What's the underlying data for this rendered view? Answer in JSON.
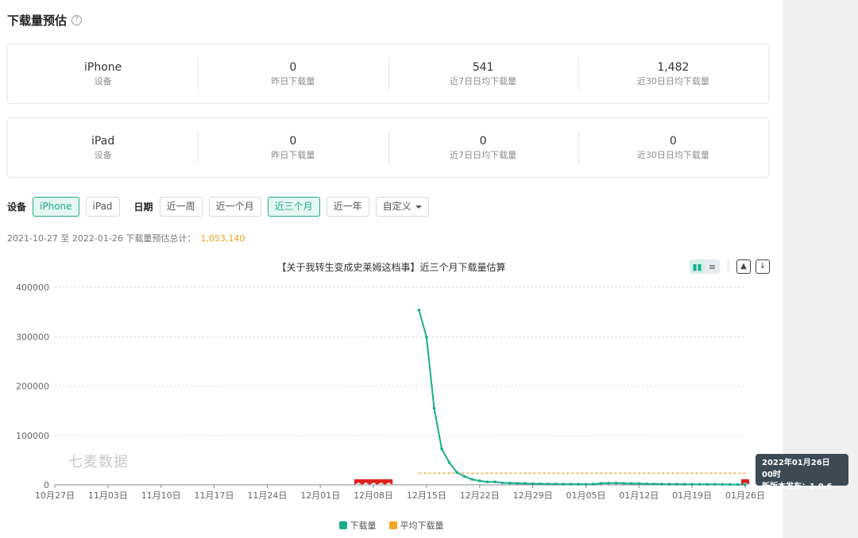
{
  "header": {
    "title": "下载量预估",
    "help_icon": "question-circle-icon"
  },
  "devices_stats": [
    {
      "device": "iPhone",
      "device_label": "设备",
      "yesterday": "0",
      "yesterday_label": "昨日下载量",
      "avg7": "541",
      "avg7_label": "近7日日均下载量",
      "avg30": "1,482",
      "avg30_label": "近30日日均下载量"
    },
    {
      "device": "iPad",
      "device_label": "设备",
      "yesterday": "0",
      "yesterday_label": "昨日下载量",
      "avg7": "0",
      "avg7_label": "近7日日均下载量",
      "avg30": "0",
      "avg30_label": "近30日日均下载量"
    }
  ],
  "filters": {
    "device_label": "设备",
    "device_options": [
      "iPhone",
      "iPad"
    ],
    "device_selected": "iPhone",
    "date_label": "日期",
    "date_options": [
      "近一周",
      "近一个月",
      "近三个月",
      "近一年",
      "自定义"
    ],
    "date_selected": "近三个月"
  },
  "summary": {
    "text": "2021-10-27 至 2022-01-26 下载量预估总计：",
    "total": "1,053,140"
  },
  "watermark": "七麦数据",
  "tooltip": {
    "line1": "2022年01月26日 00时",
    "line2": "新版本发布：1.0.6"
  },
  "colors": {
    "accent": "#1aad8c",
    "average": "#f5a623",
    "release_flag": "#e02020"
  },
  "chart_data": {
    "type": "line",
    "title": "【关于我转生变成史莱姆这档事】近三个月下载量估算",
    "start_date": "2021-10-27",
    "x_tick_labels": [
      "10月27日",
      "11月03日",
      "11月10日",
      "11月17日",
      "11月24日",
      "12月01日",
      "12月08日",
      "12月15日",
      "12月22日",
      "12月29日",
      "01月05日",
      "01月12日",
      "01月19日",
      "01月26日"
    ],
    "ylim": [
      0,
      400000
    ],
    "y_ticks": [
      0,
      100000,
      200000,
      300000,
      400000
    ],
    "grid": true,
    "legend": "bottom-center",
    "series": [
      {
        "name": "下载量",
        "color": "#1aad8c",
        "x": [
          "2021-12-14",
          "2021-12-15",
          "2021-12-16",
          "2021-12-17",
          "2021-12-18",
          "2021-12-19",
          "2021-12-20",
          "2021-12-21",
          "2021-12-22",
          "2021-12-23",
          "2021-12-24",
          "2021-12-25",
          "2021-12-26",
          "2021-12-27",
          "2021-12-28",
          "2021-12-29",
          "2021-12-30",
          "2021-12-31",
          "2022-01-01",
          "2022-01-02",
          "2022-01-03",
          "2022-01-04",
          "2022-01-05",
          "2022-01-06",
          "2022-01-07",
          "2022-01-08",
          "2022-01-09",
          "2022-01-10",
          "2022-01-11",
          "2022-01-12",
          "2022-01-13",
          "2022-01-14",
          "2022-01-15",
          "2022-01-16",
          "2022-01-17",
          "2022-01-18",
          "2022-01-19",
          "2022-01-20",
          "2022-01-21",
          "2022-01-22",
          "2022-01-23",
          "2022-01-24",
          "2022-01-25",
          "2022-01-26"
        ],
        "values": [
          354000,
          299000,
          155000,
          73000,
          45000,
          25000,
          17000,
          11000,
          8000,
          6000,
          6000,
          4000,
          3500,
          3000,
          2800,
          2200,
          2000,
          1800,
          1600,
          1500,
          1400,
          1300,
          1200,
          1500,
          3000,
          3500,
          3500,
          3000,
          2500,
          2500,
          2000,
          1800,
          1500,
          1300,
          1200,
          1100,
          1000,
          1000,
          900,
          900,
          800,
          700,
          600,
          500
        ]
      },
      {
        "name": "平均下载量",
        "color": "#f5a623",
        "dashed": true,
        "x": [
          "2021-12-14",
          "2022-01-26"
        ],
        "values": [
          23400,
          23400
        ]
      }
    ],
    "release_markers": [
      "2021-12-06",
      "2021-12-07",
      "2021-12-08",
      "2021-12-09",
      "2021-12-10",
      "2022-01-26"
    ]
  }
}
